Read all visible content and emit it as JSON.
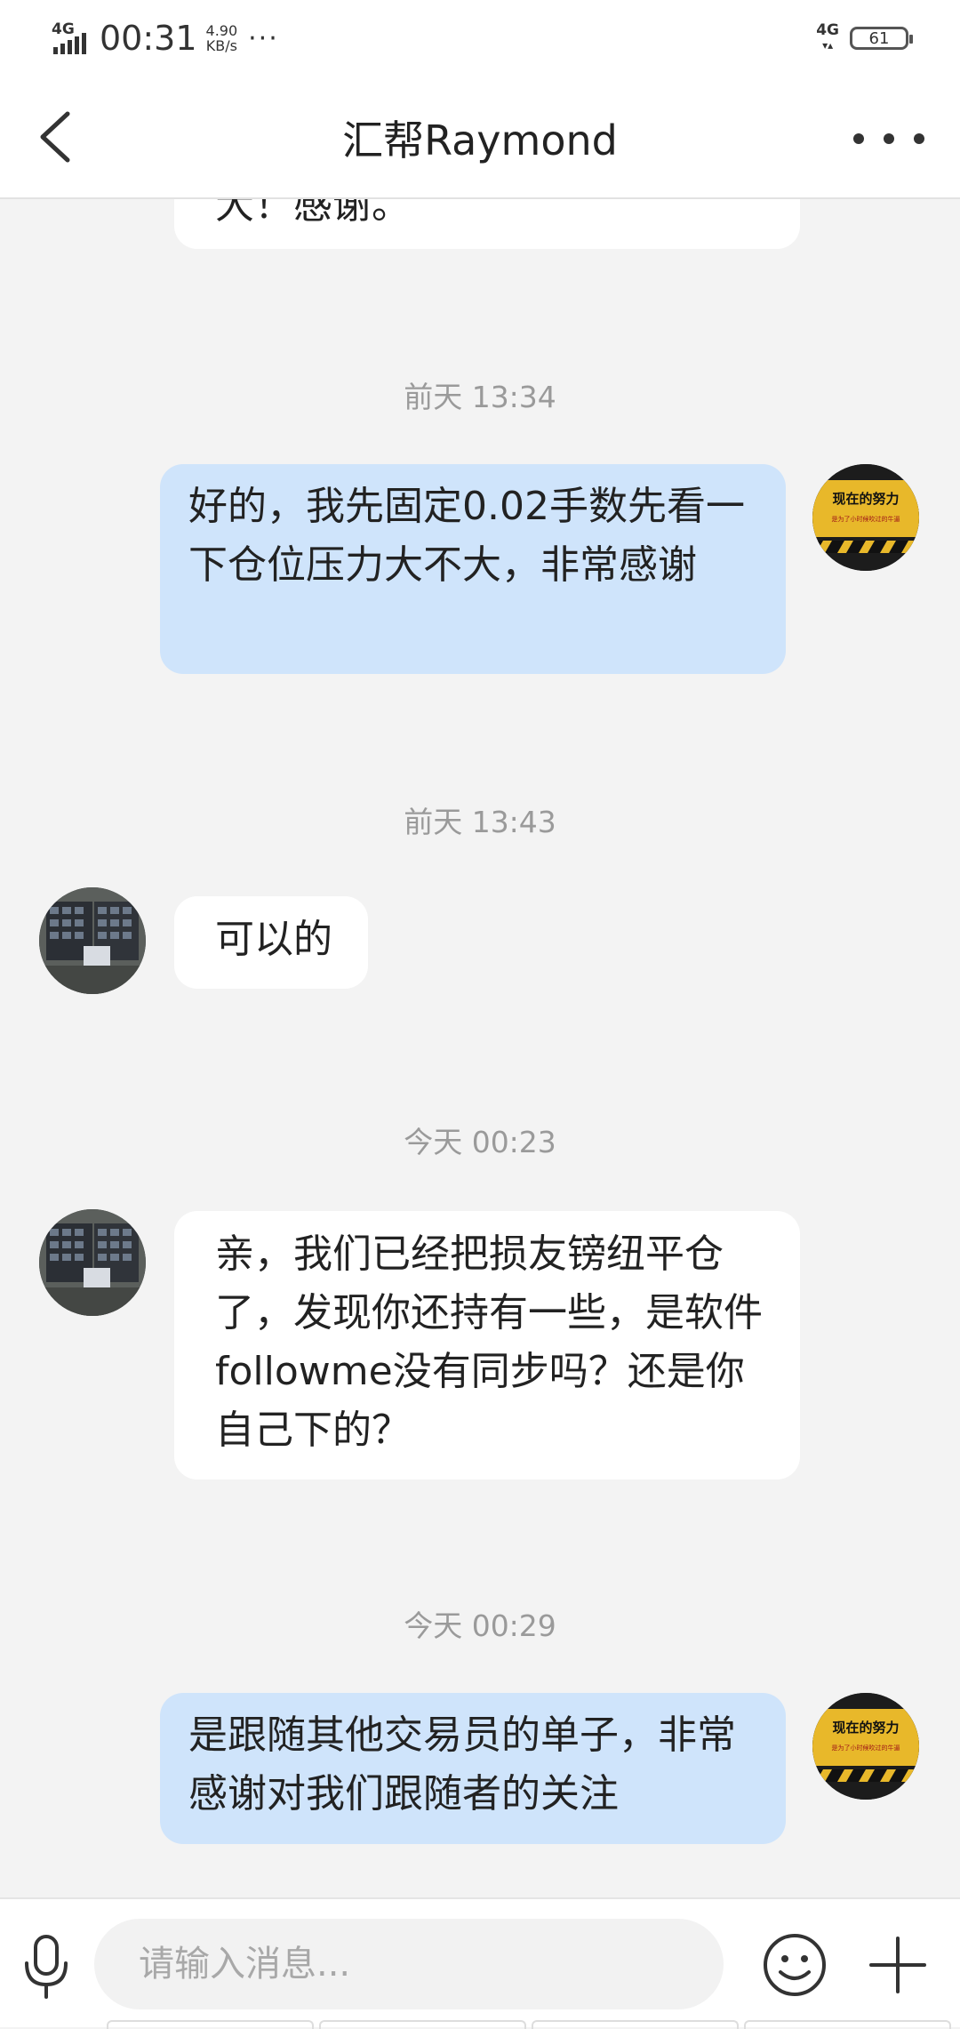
{
  "status_bar": {
    "network_left": "4G",
    "time": "00:31",
    "speed_value": "4.90",
    "speed_unit": "KB/s",
    "more": "···",
    "network_right": "4G",
    "battery": "61"
  },
  "header": {
    "title": "汇帮Raymond"
  },
  "chat": {
    "partial_message": "大！感谢。",
    "timestamps": [
      "前天 13:34",
      "前天 13:43",
      "今天 00:23",
      "今天 00:29"
    ],
    "messages": [
      {
        "sender": "me",
        "text": "好的，我先固定0.02手数先看一下仓位压力大不大，非常感谢"
      },
      {
        "sender": "them",
        "text": "可以的"
      },
      {
        "sender": "them",
        "text": "亲，我们已经把损友镑纽平仓了，发现你还持有一些，是软件followme没有同步吗？还是你自己下的？"
      },
      {
        "sender": "me",
        "text": "是跟随其他交易员的单子，非常感谢对我们跟随者的关注"
      }
    ],
    "my_avatar_text": {
      "line1": "现在的努力",
      "line2": "是为了小时候吹过的牛逼"
    }
  },
  "input": {
    "placeholder": "请输入消息..."
  },
  "colors": {
    "out_bubble": "#cfe4fb",
    "in_bubble": "#ffffff",
    "background": "#f3f3f3",
    "avatar_yellow": "#e8b82a"
  },
  "icons": {
    "back": "chevron-left-icon",
    "more": "more-dots-icon",
    "mic": "microphone-icon",
    "emoji": "smiley-icon",
    "plus": "plus-icon"
  }
}
